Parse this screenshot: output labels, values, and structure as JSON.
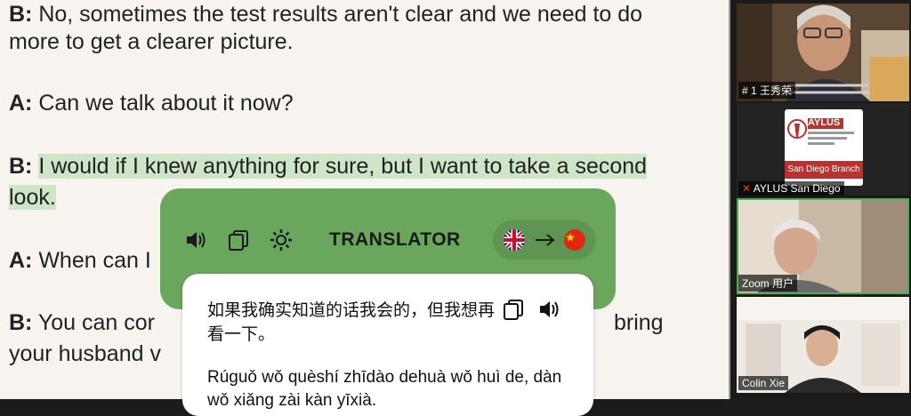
{
  "document": {
    "line1": {
      "speaker": "B:",
      "text": " No, sometimes the test results aren't clear and we need to do"
    },
    "line1b": "more to get a clearer picture.",
    "line2": {
      "speaker": "A:",
      "text": " Can we talk about it now?"
    },
    "line3": {
      "speaker": "B:",
      "text": " I would if I knew anything for sure, but I want to take a second",
      "cont": "look."
    },
    "line4": {
      "speaker": "A:",
      "text": " When can I"
    },
    "line5": {
      "speaker": "B:",
      "text": " You can cor",
      "tail": "bring"
    },
    "line5b": "your husband v"
  },
  "translator": {
    "title": "TRANSLATOR",
    "source_lang": "en",
    "target_lang": "zh",
    "chinese": "如果我确实知道的话我会的，但我想再看一下。",
    "pinyin": "Rúguǒ wǒ quèshí zhīdào dehuà wǒ huì de, dàn wǒ xiǎng zài kàn yīxià."
  },
  "participants": [
    {
      "name": "# 1 王秀荣"
    },
    {
      "name": "AYLUS San Diego",
      "logo_text": "AYLUS",
      "logo_sub": "The Alliance of Youth Leaders in the United States",
      "branch": "San Diego Branch"
    },
    {
      "name": "Zoom 用户"
    },
    {
      "name": "Colin Xie"
    }
  ],
  "colors": {
    "highlight": "#cfe5c7",
    "translator_green": "#6aa65c",
    "active_speaker": "#4caf50",
    "brand_red": "#b8322f"
  }
}
